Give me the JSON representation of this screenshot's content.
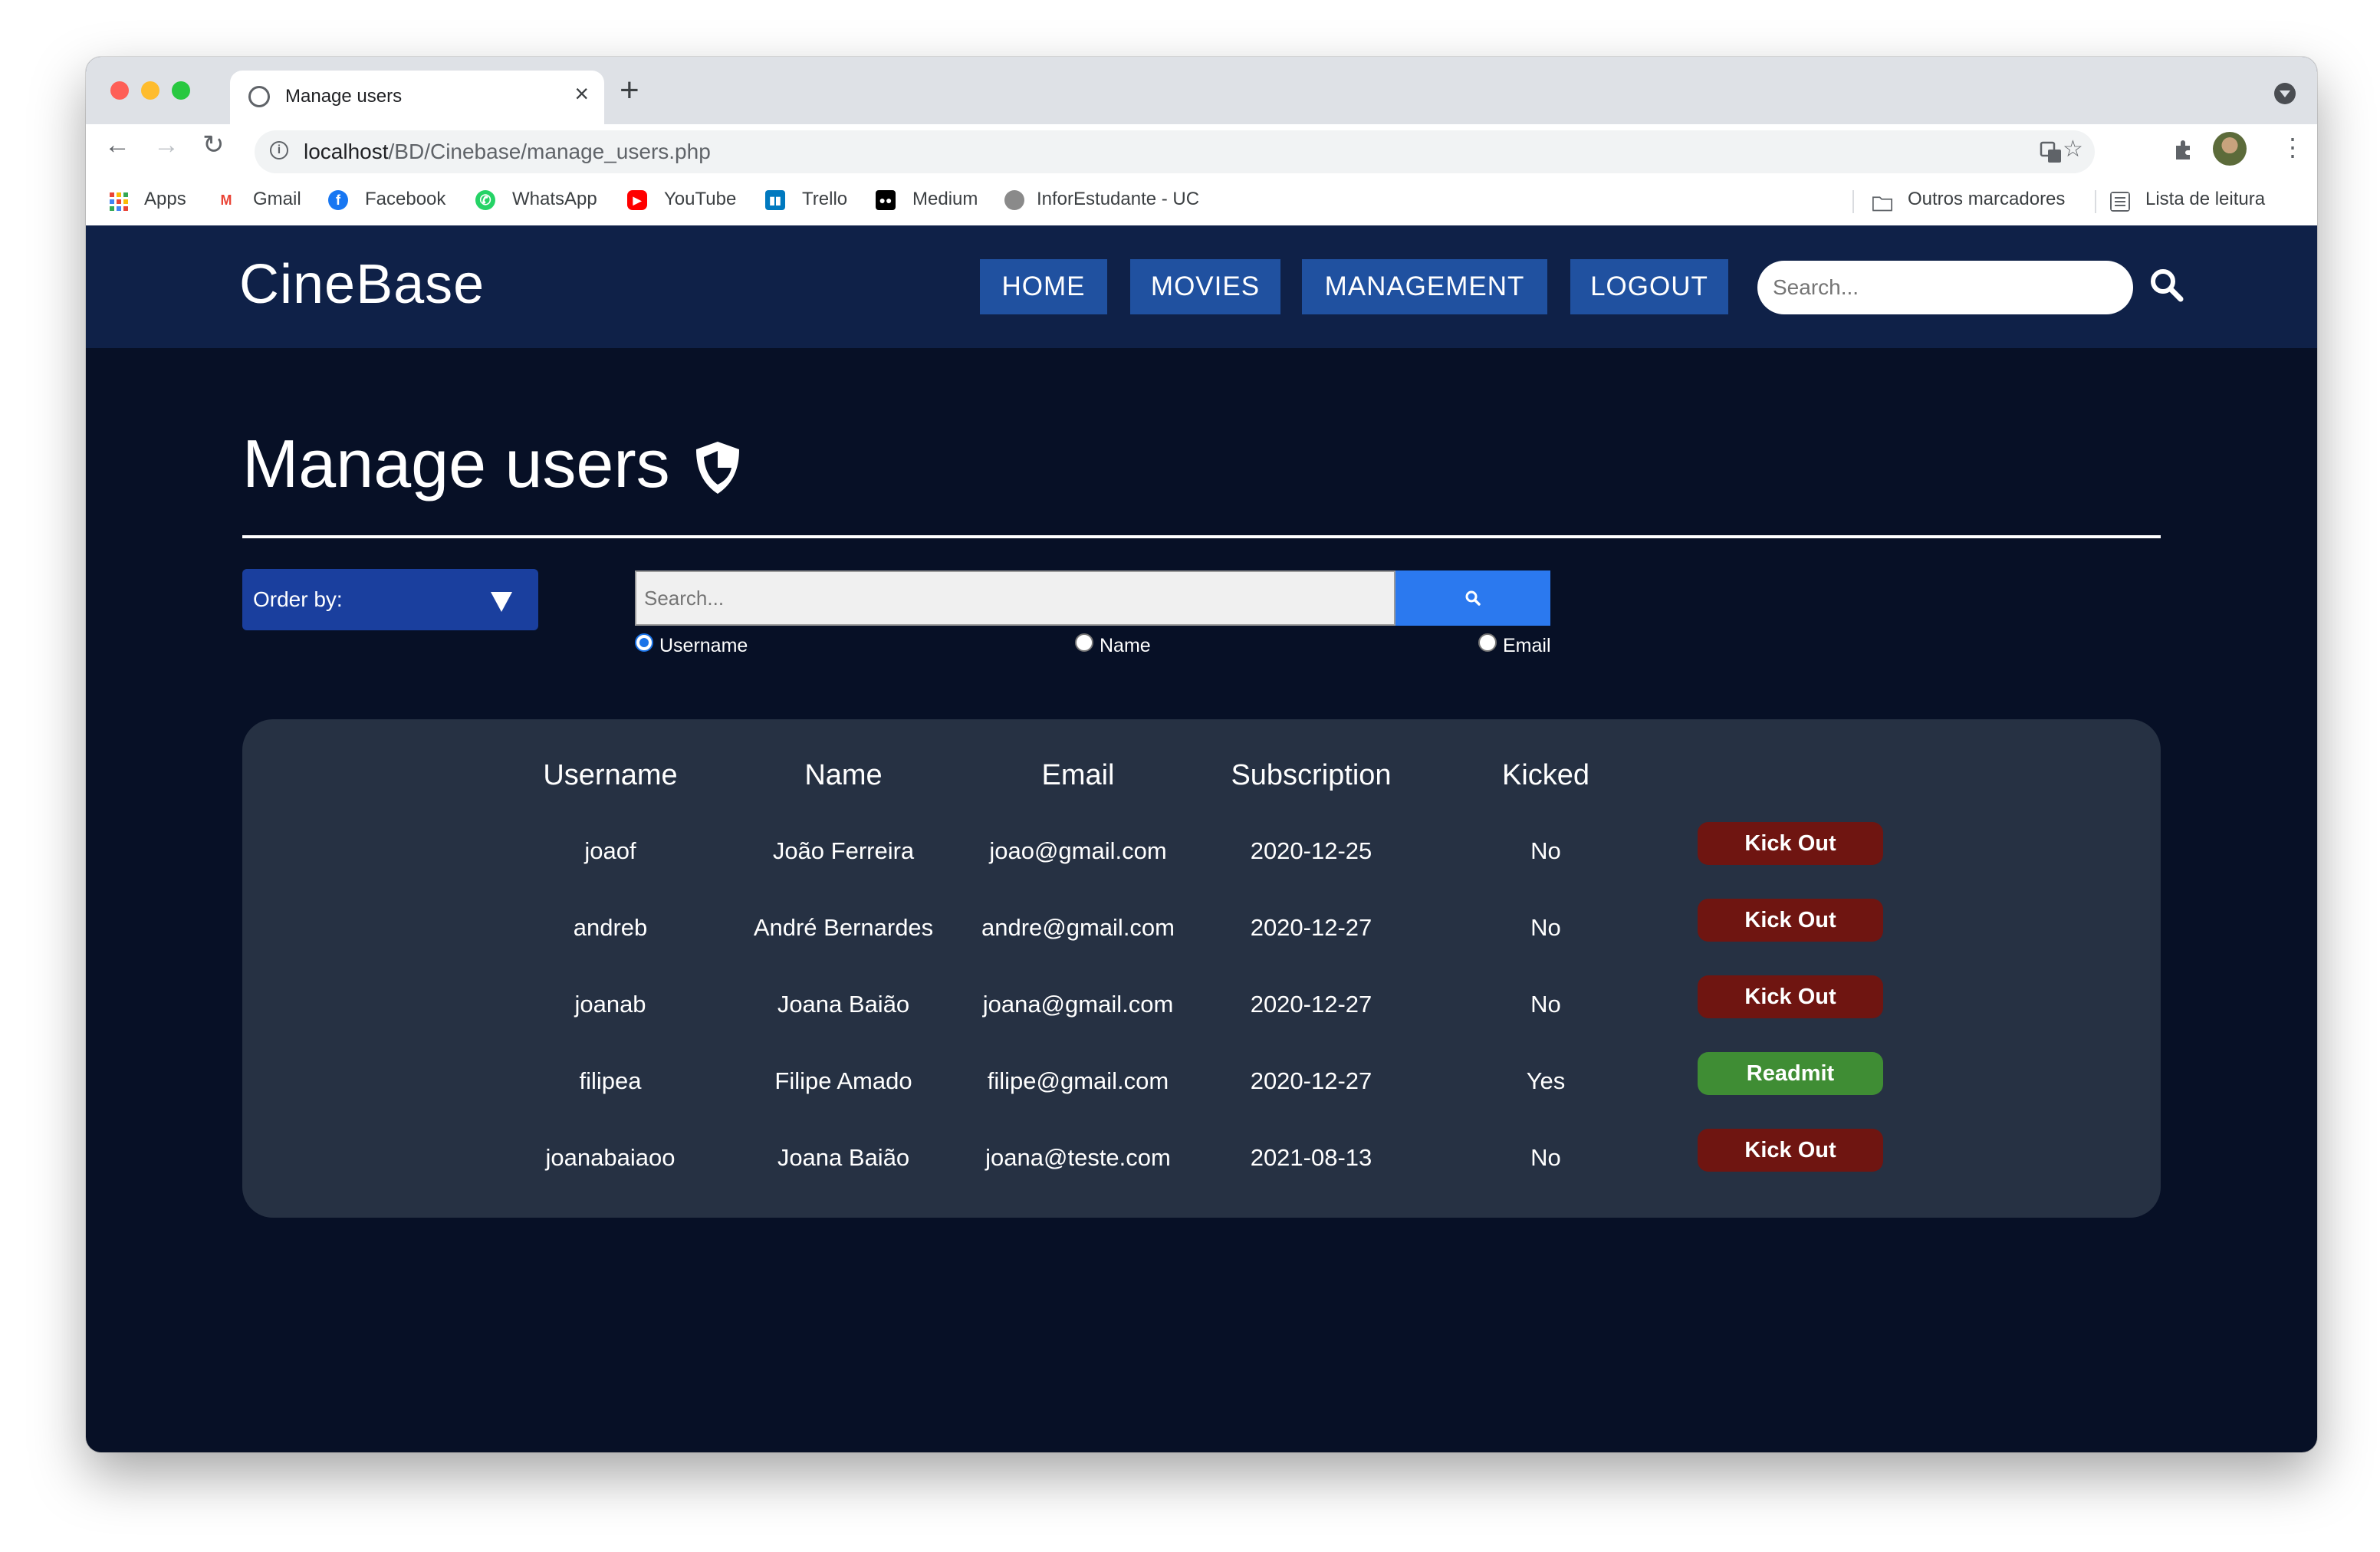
{
  "browser": {
    "tab_title": "Manage users",
    "tab_close": "×",
    "new_tab": "+",
    "url_host": "localhost",
    "url_path": "/BD/Cinebase/manage_users.php",
    "bookmarks": [
      {
        "label": "Apps",
        "icon": "apps-grid-icon"
      },
      {
        "label": "Gmail",
        "icon": "gmail-icon"
      },
      {
        "label": "Facebook",
        "icon": "facebook-icon"
      },
      {
        "label": "WhatsApp",
        "icon": "whatsapp-icon"
      },
      {
        "label": "YouTube",
        "icon": "youtube-icon"
      },
      {
        "label": "Trello",
        "icon": "trello-icon"
      },
      {
        "label": "Medium",
        "icon": "medium-icon"
      },
      {
        "label": "InforEstudante - UC",
        "icon": "inforestudante-icon"
      }
    ],
    "other_bookmarks": "Outros marcadores",
    "reading_list": "Lista de leitura"
  },
  "site": {
    "logo": "CineBase",
    "nav": [
      "HOME",
      "MOVIES",
      "MANAGEMENT",
      "LOGOUT"
    ],
    "search_placeholder": "Search..."
  },
  "page": {
    "title": "Manage users",
    "order_by_label": "Order by:",
    "user_search_placeholder": "Search...",
    "search_filters": [
      {
        "label": "Username",
        "checked": true
      },
      {
        "label": "Name",
        "checked": false
      },
      {
        "label": "Email",
        "checked": false
      }
    ]
  },
  "table": {
    "headers": [
      "Username",
      "Name",
      "Email",
      "Subscription",
      "Kicked"
    ],
    "rows": [
      {
        "username": "joaof",
        "name": "João Ferreira",
        "email": "joao@gmail.com",
        "subscription": "2020-12-25",
        "kicked": "No",
        "action": "Kick Out"
      },
      {
        "username": "andreb",
        "name": "André Bernardes",
        "email": "andre@gmail.com",
        "subscription": "2020-12-27",
        "kicked": "No",
        "action": "Kick Out"
      },
      {
        "username": "joanab",
        "name": "Joana Baião",
        "email": "joana@gmail.com",
        "subscription": "2020-12-27",
        "kicked": "No",
        "action": "Kick Out"
      },
      {
        "username": "filipea",
        "name": "Filipe Amado",
        "email": "filipe@gmail.com",
        "subscription": "2020-12-27",
        "kicked": "Yes",
        "action": "Readmit"
      },
      {
        "username": "joanabaiaoo",
        "name": "Joana Baião",
        "email": "joana@teste.com",
        "subscription": "2021-08-13",
        "kicked": "No",
        "action": "Kick Out"
      }
    ]
  },
  "colors": {
    "header_bg": "#0f2148",
    "page_bg": "#071026",
    "nav_button": "#2051a0",
    "card_bg": "#263143",
    "kick_out": "#6f1511",
    "readmit": "#3f8d34",
    "search_button": "#2b79ef"
  }
}
